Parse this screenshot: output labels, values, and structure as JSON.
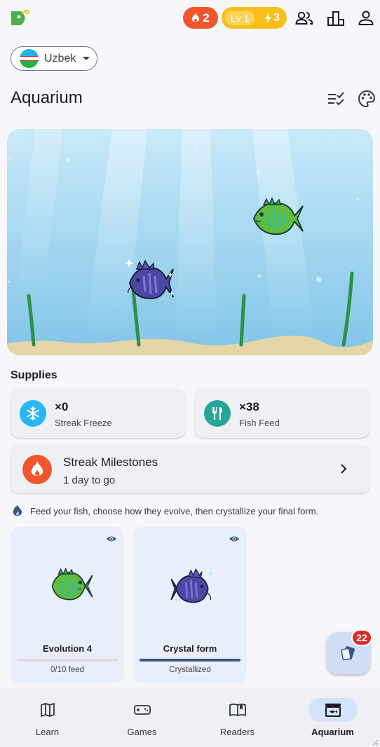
{
  "header": {
    "streak_count": "2",
    "level_label": "Lv 1",
    "energy_count": "3",
    "icons": [
      "friends-icon",
      "leaderboard-icon",
      "profile-icon"
    ]
  },
  "language": {
    "selected": "Uzbek"
  },
  "page": {
    "title": "Aquarium"
  },
  "supplies": {
    "heading": "Supplies",
    "streak_freeze": {
      "count": "×0",
      "label": "Streak Freeze",
      "color": "#29b6f6"
    },
    "fish_feed": {
      "count": "×38",
      "label": "Fish Feed",
      "color": "#26a69a"
    }
  },
  "milestones": {
    "title": "Streak Milestones",
    "subtitle": "1 day to go",
    "color": "#f2552c"
  },
  "info": {
    "text": "Feed your fish, choose how they evolve, then crystallize your final form."
  },
  "fish_cards": [
    {
      "name": "Evolution 4",
      "status": "0/10 feed",
      "progress": 0.0
    },
    {
      "name": "Crystal form",
      "status": "Crystallized",
      "progress": 1.0
    }
  ],
  "fab": {
    "badge": "22"
  },
  "nav": {
    "items": [
      {
        "label": "Learn",
        "icon": "map-icon"
      },
      {
        "label": "Games",
        "icon": "gamepad-icon"
      },
      {
        "label": "Readers",
        "icon": "book-icon"
      },
      {
        "label": "Aquarium",
        "icon": "aquarium-icon",
        "active": true
      }
    ]
  },
  "colors": {
    "accent": "#36587f",
    "streak": "#f2552c",
    "level": "#f9be19",
    "nav_active": "#d4e3f9",
    "card": "#eef0f4"
  }
}
